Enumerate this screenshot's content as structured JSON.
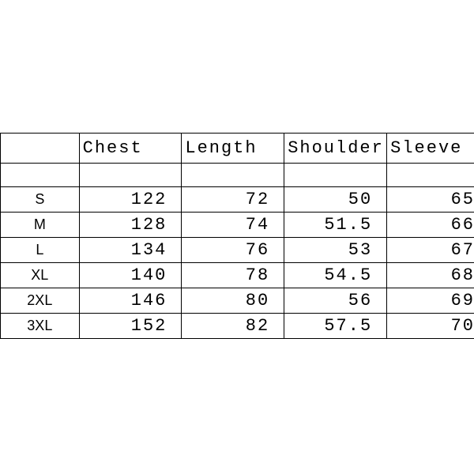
{
  "chart_data": {
    "type": "table",
    "headers": [
      "",
      "Chest",
      "Length",
      "Shoulder",
      "Sleeve"
    ],
    "rows": [
      {
        "size": "S",
        "chest": "122",
        "length": "72",
        "shoulder": "50",
        "sleeve": "65"
      },
      {
        "size": "M",
        "chest": "128",
        "length": "74",
        "shoulder": "51.5",
        "sleeve": "66"
      },
      {
        "size": "L",
        "chest": "134",
        "length": "76",
        "shoulder": "53",
        "sleeve": "67"
      },
      {
        "size": "XL",
        "chest": "140",
        "length": "78",
        "shoulder": "54.5",
        "sleeve": "68"
      },
      {
        "size": "2XL",
        "chest": "146",
        "length": "80",
        "shoulder": "56",
        "sleeve": "69"
      },
      {
        "size": "3XL",
        "chest": "152",
        "length": "82",
        "shoulder": "57.5",
        "sleeve": "70"
      }
    ]
  }
}
